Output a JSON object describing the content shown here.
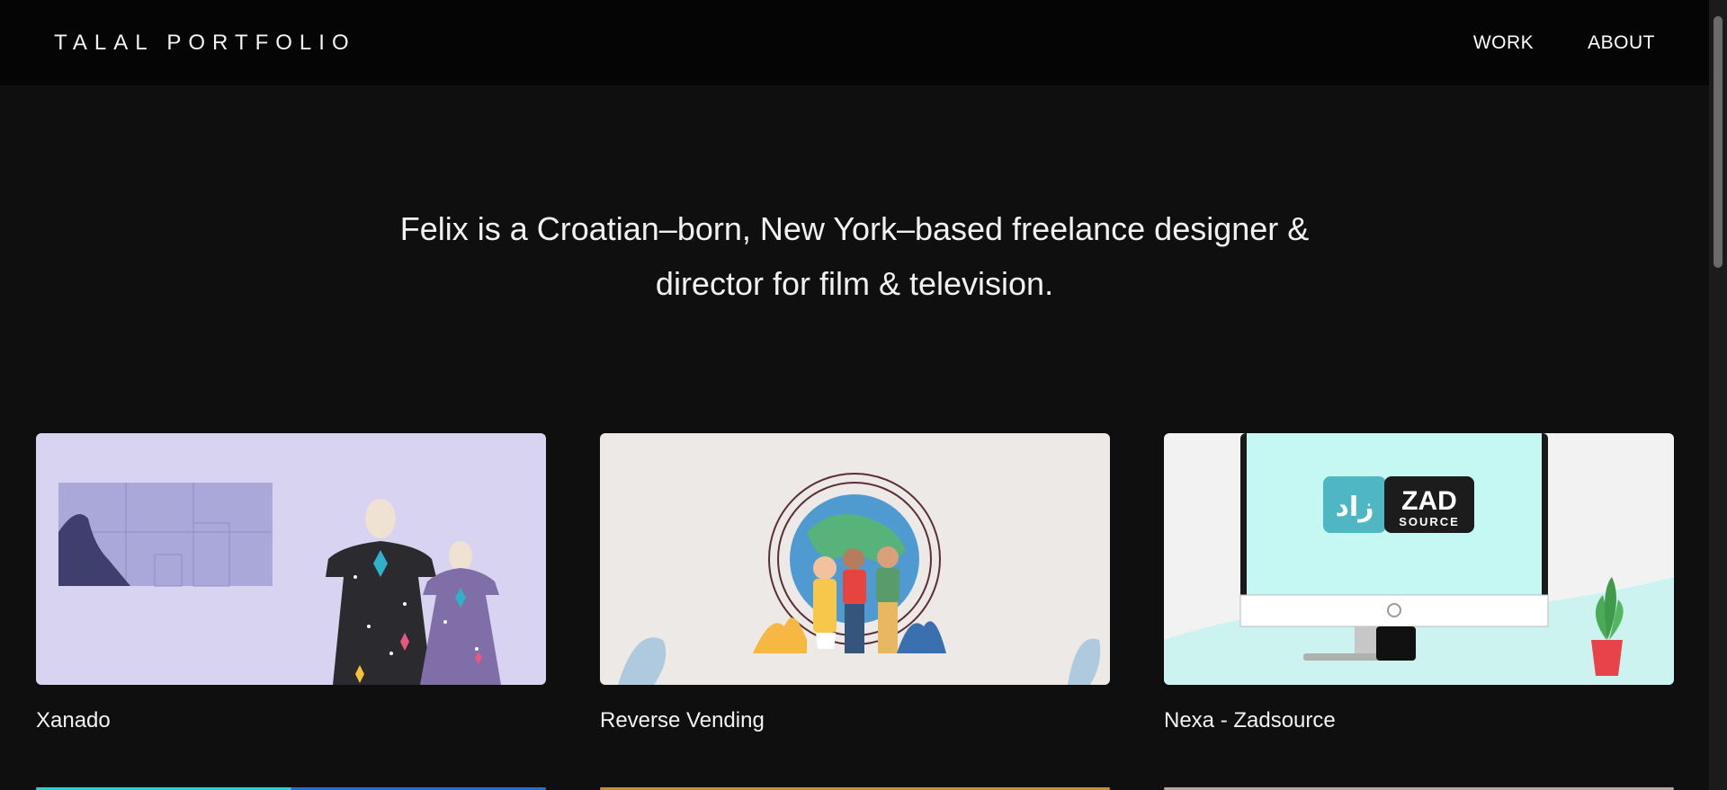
{
  "header": {
    "brand": "TALAL PORTFOLIO",
    "nav": [
      {
        "label": "WORK"
      },
      {
        "label": "ABOUT"
      }
    ]
  },
  "hero": {
    "text": "Felix is a Croatian–born, New York–based freelance designer & director for film & television."
  },
  "projects": [
    {
      "title": "Xanado"
    },
    {
      "title": "Reverse Vending"
    },
    {
      "title": "Nexa - Zadsource",
      "logo_word": "ZAD",
      "logo_sub": "SOURCE",
      "logo_arabic": "زاد"
    }
  ],
  "colors": {
    "background": "#0f0f0f",
    "header_bg": "#050505",
    "text": "#ffffff"
  }
}
